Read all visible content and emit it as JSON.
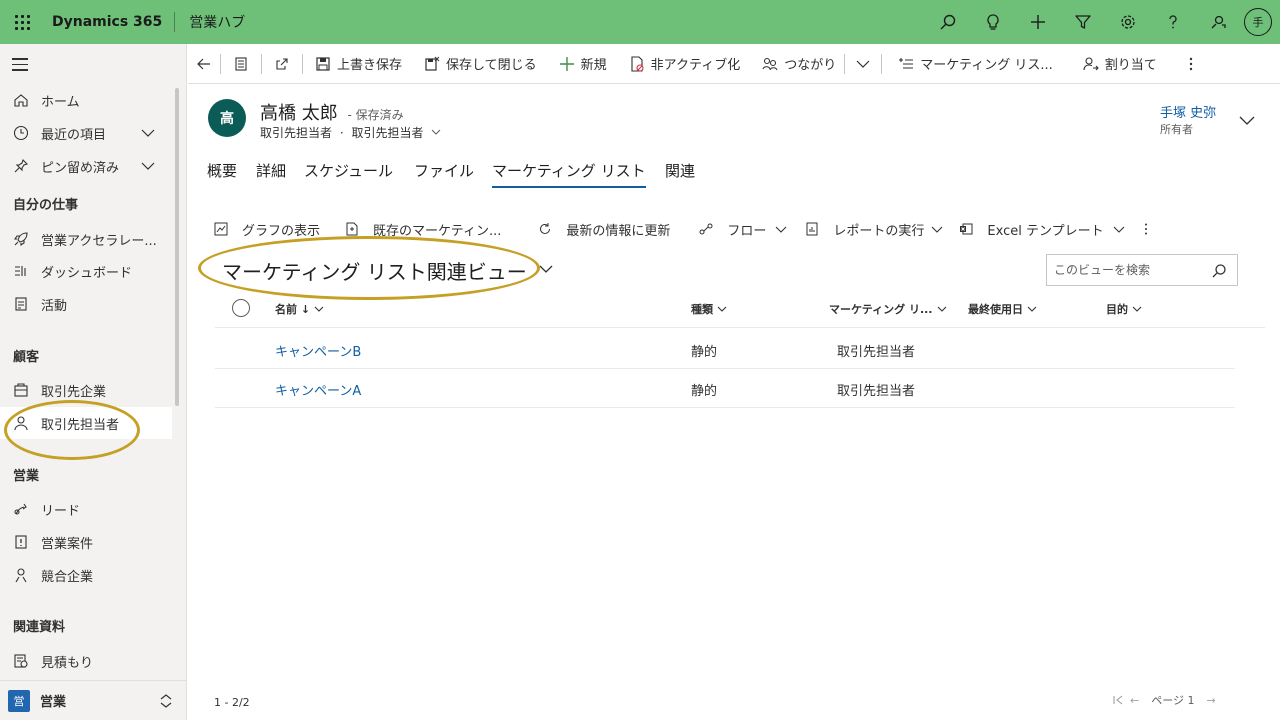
{
  "topbar": {
    "app_name": "Dynamics 365",
    "hub_name": "営業ハブ",
    "icons": [
      "search-icon",
      "lightbulb-icon",
      "plus-icon",
      "filter-icon",
      "gear-icon",
      "help-icon",
      "chat-icon"
    ],
    "user_initial": "手"
  },
  "sidebar": {
    "items": [
      {
        "label": "ホーム",
        "icon": "home-icon"
      },
      {
        "label": "最近の項目",
        "icon": "clock-icon"
      },
      {
        "label": "ピン留め済み",
        "icon": "pin-icon"
      }
    ],
    "sections": {
      "my_work": "自分の仕事",
      "customers": "顧客",
      "sales": "営業",
      "collateral": "関連資料"
    },
    "my_work_items": [
      {
        "label": "営業アクセラレー...",
        "icon": "rocket-icon"
      },
      {
        "label": "ダッシュボード",
        "icon": "dashboard-icon"
      },
      {
        "label": "活動",
        "icon": "activity-icon"
      }
    ],
    "customer_items": [
      {
        "label": "取引先企業",
        "icon": "account-icon"
      },
      {
        "label": "取引先担当者",
        "icon": "contact-icon"
      }
    ],
    "sales_items": [
      {
        "label": "リード",
        "icon": "lead-icon"
      },
      {
        "label": "営業案件",
        "icon": "opportunity-icon"
      },
      {
        "label": "競合企業",
        "icon": "competitor-icon"
      }
    ],
    "collateral_items": [
      {
        "label": "見積もり",
        "icon": "quote-icon"
      }
    ],
    "area": {
      "badge": "営",
      "label": "営業"
    }
  },
  "commandbar": {
    "save": "上書き保存",
    "save_close": "保存して閉じる",
    "new": "新規",
    "deactivate": "非アクティブ化",
    "connect": "つながり",
    "add_marketing": "マーケティング リス...",
    "assign": "割り当て"
  },
  "record": {
    "initial": "高",
    "name": "高橋 太郎",
    "status": "- 保存済み",
    "entity": "取引先担当者",
    "form": "取引先担当者",
    "owner_name": "手塚 史弥",
    "owner_label": "所有者"
  },
  "tabs": [
    "概要",
    "詳細",
    "スケジュール",
    "ファイル",
    "マーケティング リスト",
    "関連"
  ],
  "subgrid_toolbar": {
    "show_chart": "グラフの表示",
    "add_existing": "既存のマーケティン...",
    "refresh": "最新の情報に更新",
    "flow": "フロー",
    "run_report": "レポートの実行",
    "excel_templates": "Excel テンプレート"
  },
  "view": {
    "title": "マーケティング リスト関連ビュー",
    "search_placeholder": "このビューを検索"
  },
  "grid": {
    "columns": [
      "名前 ↓",
      "種類",
      "マーケティング リ...",
      "最終使用日",
      "目的"
    ],
    "rows": [
      {
        "name": "キャンペーンB",
        "type": "静的",
        "member_type": "取引先担当者"
      },
      {
        "name": "キャンペーンA",
        "type": "静的",
        "member_type": "取引先担当者"
      }
    ]
  },
  "footer": {
    "count": "1 - 2/2",
    "page": "ページ 1"
  },
  "colors": {
    "topbar": "#6ec079",
    "accent": "#115ea3",
    "annotation": "#c6a025",
    "avatar": "#0b5b56"
  }
}
